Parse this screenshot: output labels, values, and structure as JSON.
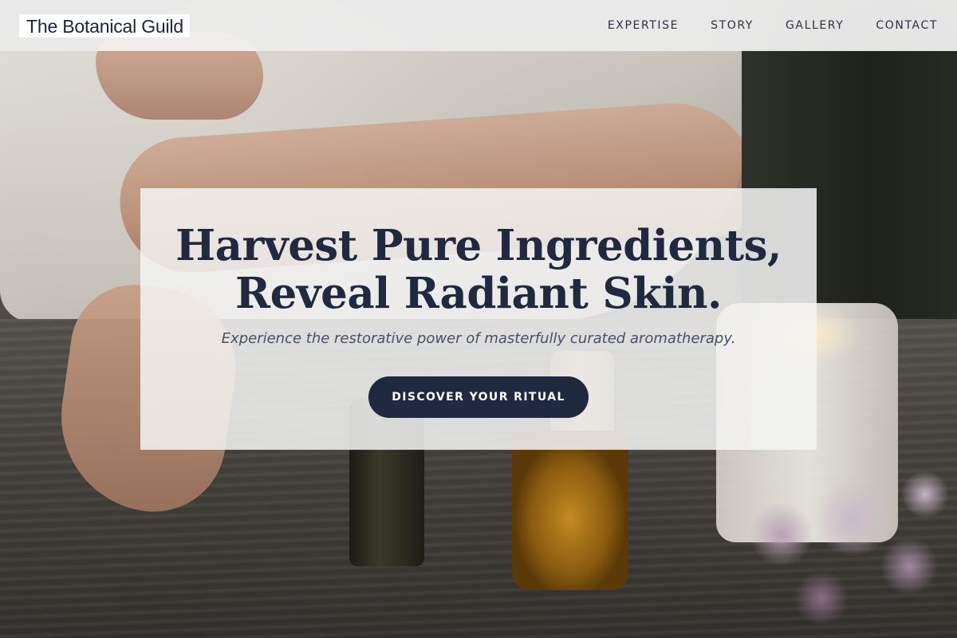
{
  "header": {
    "brand": "The Botanical Guild",
    "nav": [
      {
        "label": "EXPERTISE"
      },
      {
        "label": "STORY"
      },
      {
        "label": "GALLERY"
      },
      {
        "label": "CONTACT"
      }
    ]
  },
  "hero": {
    "title_line1": "Harvest Pure Ingredients,",
    "title_line2": "Reveal Radiant Skin.",
    "subtitle": "Experience the restorative power of masterfully curated aromatherapy.",
    "cta_label": "DISCOVER YOUR RITUAL"
  },
  "colors": {
    "primary": "#1f2940",
    "header_bg": "#f3f3f3",
    "card_bg": "#f4f4f4",
    "subtitle": "#47506a",
    "button_text": "#ffffff"
  }
}
